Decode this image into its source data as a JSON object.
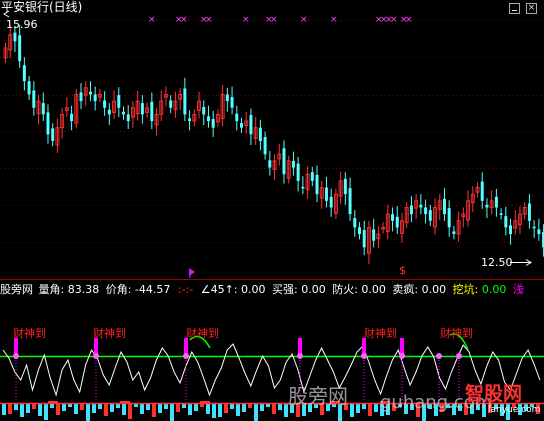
{
  "window": {
    "title": "平安银行(日线)",
    "controls": [
      "minimize-icon",
      "close-icon"
    ]
  },
  "main_panel": {
    "high_price_label": "15.96",
    "low_price_label": "12.50",
    "price_markers": [
      "×",
      "×",
      "×",
      "×",
      "×",
      "×",
      "×",
      "×",
      "×",
      "×",
      "×",
      "×",
      "×",
      "×",
      "×",
      "×"
    ],
    "shift_marker": "$"
  },
  "indicator_header": {
    "name": "股旁网",
    "items": [
      {
        "label": "量角: ",
        "value": "83.38"
      },
      {
        "label": "价角: ",
        "value": "-44.57"
      },
      {
        "label": "",
        "value": ":-:-"
      },
      {
        "label": "∠45↑: ",
        "value": "0.00"
      },
      {
        "label": "买强: ",
        "value": "0.00"
      },
      {
        "label": "防火: ",
        "value": "0.00"
      },
      {
        "label": "卖疯: ",
        "value": "0.00"
      },
      {
        "label": "挖坑: ",
        "value": "0.00"
      },
      {
        "label": "",
        "value": "浅"
      }
    ]
  },
  "signals": {
    "label": "财神到",
    "count": 6
  },
  "watermarks": {
    "left": "股旁网",
    "middle": "guhang.com",
    "right_logo": "智股网",
    "right_url": "lanyue.com"
  },
  "colors": {
    "background": "#000000",
    "up_candle": "#ff3232",
    "down_candle": "#54ffff",
    "signal_text": "#ff2020",
    "signal_bar": "#ff00ff",
    "baseline": "#00ff00",
    "white_line": "#ffffff",
    "header_text": "#ffffff",
    "header_green": "#00ff00",
    "header_yellow": "#ffff00"
  },
  "chart_data": {
    "type": "candlestick",
    "title": "平安银行(日线)",
    "price_range": [
      12.5,
      15.96
    ],
    "closes": [
      15.6,
      15.8,
      15.7,
      15.4,
      15.1,
      14.9,
      14.7,
      14.8,
      14.6,
      14.3,
      14.2,
      14.4,
      14.6,
      14.7,
      14.5,
      14.9,
      14.8,
      15.0,
      14.9,
      14.8,
      14.9,
      14.7,
      14.6,
      14.8,
      14.7,
      14.6,
      14.5,
      14.7,
      14.8,
      14.6,
      14.7,
      14.5,
      14.6,
      14.8,
      14.9,
      14.7,
      14.8,
      14.9,
      14.6,
      14.5,
      14.6,
      14.8,
      14.6,
      14.5,
      14.4,
      14.6,
      14.9,
      14.8,
      14.7,
      14.5,
      14.4,
      14.5,
      14.3,
      14.4,
      14.2,
      14.0,
      13.8,
      13.9,
      14.0,
      13.7,
      13.9,
      13.8,
      13.6,
      13.5,
      13.7,
      13.6,
      13.4,
      13.5,
      13.3,
      13.2,
      13.4,
      13.6,
      13.4,
      13.1,
      12.9,
      12.8,
      12.6,
      12.9,
      12.7,
      12.8,
      12.9,
      13.1,
      13.0,
      12.9,
      13.0,
      13.2,
      13.1,
      13.3,
      13.2,
      13.1,
      13.0,
      13.2,
      13.3,
      13.1,
      12.9,
      12.8,
      13.0,
      13.1,
      13.3,
      13.4,
      13.5,
      13.3,
      13.2,
      13.3,
      13.2,
      13.1,
      12.9,
      12.8,
      13.0,
      13.1,
      13.2,
      13.0,
      12.9,
      12.8,
      12.6
    ]
  }
}
